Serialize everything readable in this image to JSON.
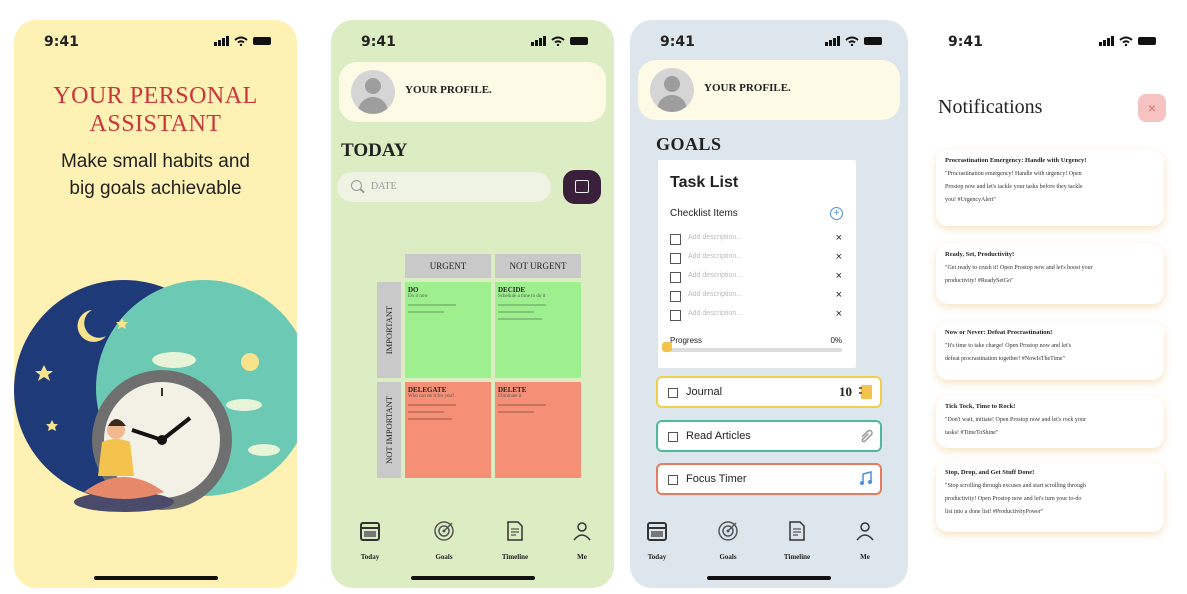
{
  "status": {
    "time": "9:41"
  },
  "screen1": {
    "headline_line1": "YOUR PERSONAL",
    "headline_line2": "ASSISTANT",
    "sub_line1": "Make small habits and",
    "sub_line2": "big goals achievable",
    "colors": {
      "background": "#fdf1b3",
      "headline": "#c8353b",
      "night": "#1f3a78",
      "day": "#6cc9b3"
    }
  },
  "profile": {
    "label": "YOUR PROFILE."
  },
  "screen2": {
    "title": "TODAY",
    "search_placeholder": "DATE",
    "matrix": {
      "col_headers": [
        "URGENT",
        "NOT URGENT"
      ],
      "row_headers": [
        "IMPORTANT",
        "NOT IMPORTANT"
      ],
      "quadrants": [
        {
          "title": "DO",
          "sub": "Do it now",
          "color": "#9ef08f"
        },
        {
          "title": "DECIDE",
          "sub": "Schedule a time to do it",
          "color": "#9ef08f"
        },
        {
          "title": "DELEGATE",
          "sub": "Who can do it for you?",
          "color": "#f58f76"
        },
        {
          "title": "DELETE",
          "sub": "Eliminate it",
          "color": "#f58f76"
        }
      ]
    },
    "colors": {
      "background": "#dcedc4"
    }
  },
  "nav": {
    "screen2": [
      "Today",
      "Goals",
      "Timeline",
      "Me"
    ],
    "screen3": [
      "Today",
      "Goals",
      "Timeline",
      "Me"
    ]
  },
  "screen3": {
    "title": "GOALS",
    "tasklist": {
      "title": "Task List",
      "subtitle": "Checklist Items",
      "placeholder": "Add description...",
      "progress_label": "Progress",
      "progress_value": "0%",
      "progress_fraction": 0
    },
    "habits": [
      {
        "label": "Journal",
        "value": "10",
        "border": "#f0cf4d",
        "icon": "notebook-icon"
      },
      {
        "label": "Read Articles",
        "value": "",
        "border": "#4fb8a0",
        "icon": "paperclip-icon"
      },
      {
        "label": "Focus Timer",
        "value": "",
        "border": "#e77b5e",
        "icon": "music-note-icon"
      }
    ],
    "colors": {
      "background": "#dde6ed"
    }
  },
  "screen4": {
    "title": "Notifications",
    "close_glyph": "×",
    "cards": [
      {
        "title": "Procrastination Emergency: Handle with Urgency!",
        "line1": "\"Procrastination emergency! Handle with urgency! Open",
        "line2": "Prostop now and let's tackle your tasks before they tackle",
        "line3": "you! #UrgencyAlert\""
      },
      {
        "title": "Ready, Set, Productivity!",
        "line1": "\"Get ready to crush it! Open Prostop now and let's boost your",
        "line2": "productivity! #ReadySetGo\""
      },
      {
        "title": "Now or Never: Defeat Procrastination!",
        "line1": "\"It's time to take charge! Open Prostop now and let's",
        "line2": "defeat procrastination together! #NowIsTheTime\""
      },
      {
        "title": "Tick Tock, Time to Rock!",
        "line1": "\"Don't wait, initiate! Open Prostop now and let's rock your",
        "line2": "tasks! #TimeToShine\""
      },
      {
        "title": "Stop, Drop, and Get Stuff Done!",
        "line1": "\"Stop scrolling through excuses and start scrolling through",
        "line2": "productivity! Open Prostop now and let's turn your to-do",
        "line3": "list into a done list! #ProductivityPower\""
      }
    ]
  }
}
